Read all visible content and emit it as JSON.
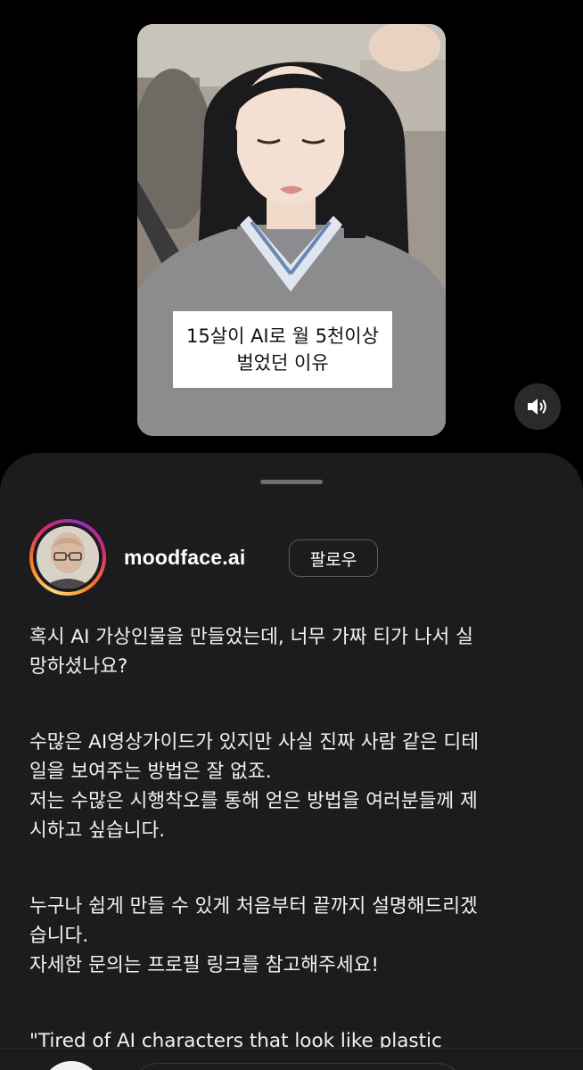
{
  "video": {
    "caption_line1": "15살이 AI로 월 5천이상",
    "caption_line2": "벌었던 이유",
    "sound_icon": "speaker-volume-icon"
  },
  "post": {
    "username": "moodface.ai",
    "follow_label": "팔로우",
    "paragraphs": [
      {
        "lines": [
          "혹시 AI 가상인물을 만들었는데, 너무 가짜 티가 나서 실",
          "망하셨나요?"
        ]
      },
      {
        "lines": [
          "수많은 AI영상가이드가 있지만 사실 진짜 사람 같은 디테",
          "일을 보여주는 방법은 잘 없죠.",
          "저는 수많은 시행착오를 통해 얻은 방법을 여러분들께 제",
          "시하고 싶습니다."
        ]
      },
      {
        "lines": [
          "누구나 쉽게 만들 수 있게 처음부터 끝까지 설명해드리겠",
          "습니다.",
          "자세한 문의는 프로필 링크를 참고해주세요!"
        ]
      },
      {
        "lines": [
          "\"Tired of AI characters that look like plastic"
        ]
      }
    ]
  },
  "colors": {
    "background": "#000000",
    "sheet": "#1c1c1e",
    "text": "#f2f2f2",
    "follow_border": "#5a5a5e"
  }
}
